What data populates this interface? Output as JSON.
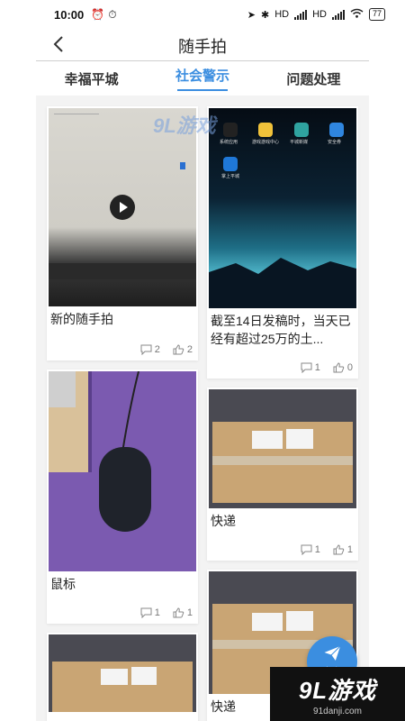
{
  "status_bar": {
    "time": "10:00",
    "network_labels": [
      "HD",
      "HD"
    ],
    "battery": "77"
  },
  "nav": {
    "title": "随手拍",
    "back_icon": "chevron-left-icon"
  },
  "tabs": [
    {
      "label": "幸福平城",
      "active": false
    },
    {
      "label": "社会警示",
      "active": true
    },
    {
      "label": "问题处理",
      "active": false
    }
  ],
  "cards": [
    {
      "title": "新的随手拍",
      "comments": "2",
      "likes": "2"
    },
    {
      "title": "截至14日发稿时，当天已经有超过25万的土...",
      "comments": "1",
      "likes": "0"
    },
    {
      "title": "鼠标",
      "comments": "1",
      "likes": "1"
    },
    {
      "title": "快递",
      "comments": "1",
      "likes": "1"
    },
    {
      "title": "",
      "comments": "",
      "likes": ""
    },
    {
      "title": "快递",
      "comments": "",
      "likes": ""
    }
  ],
  "thumb_text": {
    "phone_apps": [
      "系统应用",
      "游戏游戏中心",
      "平城新媒",
      "安全券",
      "掌上平城"
    ]
  },
  "fab": {
    "label": "发布",
    "icon": "paper-plane-icon"
  },
  "watermarks": {
    "overlay_logo": "9L游戏",
    "corner_logo": "9L游戏",
    "corner_domain": "91danji.com"
  },
  "colors": {
    "accent": "#3b8ee0",
    "background": "#f3f3f3"
  }
}
